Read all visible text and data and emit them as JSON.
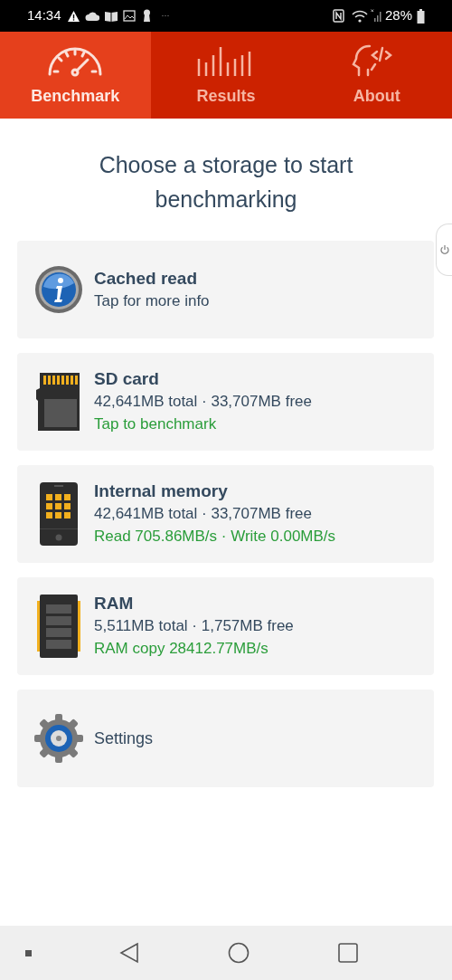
{
  "status_bar": {
    "time": "14:34",
    "more": "···",
    "battery": "28%"
  },
  "tabs": [
    {
      "label": "Benchmark",
      "kind": "gauge",
      "selected": true
    },
    {
      "label": "Results",
      "kind": "bars",
      "selected": false
    },
    {
      "label": "About",
      "kind": "head",
      "selected": false
    }
  ],
  "heading": "Choose a storage to start benchmarking",
  "cards": [
    {
      "kind": "info",
      "title": "Cached read",
      "lines": [
        {
          "kind": "note",
          "text": "Tap for more info"
        }
      ]
    },
    {
      "kind": "sdcard",
      "title": "SD card",
      "lines": [
        {
          "kind": "note",
          "text": "42,641MB total · 33,707MB free"
        },
        {
          "kind": "result",
          "text": "Tap to benchmark"
        }
      ]
    },
    {
      "kind": "phone",
      "title": "Internal memory",
      "lines": [
        {
          "kind": "note",
          "text": "42,641MB total · 33,707MB free"
        },
        {
          "kind": "result",
          "text": "Read 705.86MB/s · Write 0.00MB/s"
        }
      ]
    },
    {
      "kind": "ram",
      "title": "RAM",
      "lines": [
        {
          "kind": "note",
          "text": "5,511MB total · 1,757MB free"
        },
        {
          "kind": "result",
          "text": "RAM copy 28412.77MB/s"
        }
      ]
    },
    {
      "kind": "gear",
      "title": "Settings"
    }
  ]
}
